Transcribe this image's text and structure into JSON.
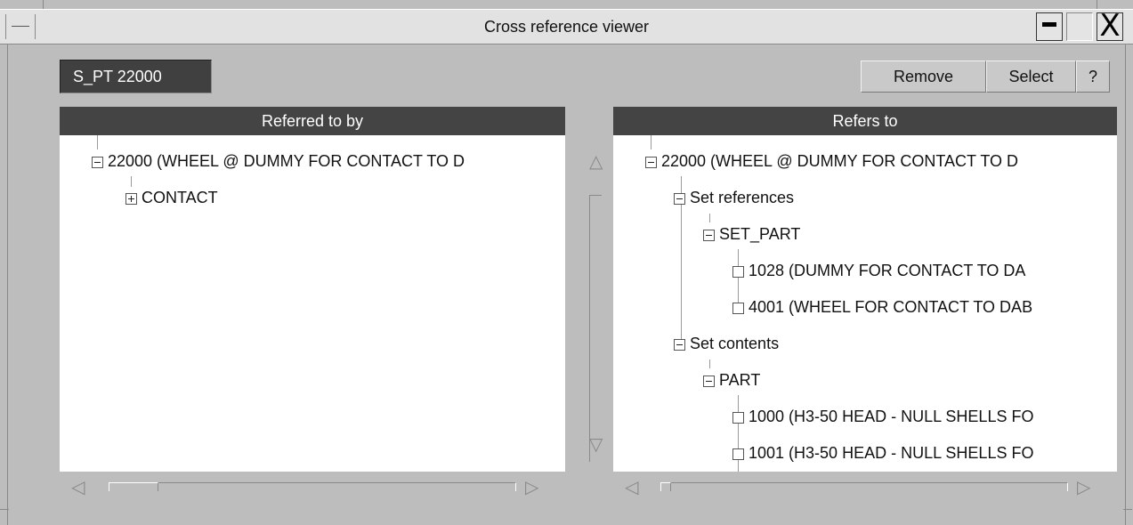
{
  "window": {
    "title": "Cross reference viewer",
    "close_glyph": "X"
  },
  "toolbar": {
    "entity_label": "S_PT 22000",
    "remove_label": "Remove",
    "select_label": "Select",
    "help_label": "?"
  },
  "left_panel": {
    "header": "Referred to by",
    "nodes": [
      {
        "label": "22000 (WHEEL @ DUMMY FOR CONTACT TO D",
        "state": "expanded"
      },
      {
        "label": "CONTACT",
        "state": "collapsed"
      }
    ]
  },
  "right_panel": {
    "header": "Refers to",
    "nodes": [
      {
        "label": "22000 (WHEEL @ DUMMY FOR CONTACT TO D",
        "state": "expanded"
      },
      {
        "label": "Set references",
        "state": "expanded"
      },
      {
        "label": "SET_PART",
        "state": "expanded"
      },
      {
        "label": "1028 (DUMMY FOR CONTACT TO DA",
        "state": "leaf"
      },
      {
        "label": "4001 (WHEEL FOR CONTACT TO DAB",
        "state": "leaf"
      },
      {
        "label": "Set contents",
        "state": "expanded"
      },
      {
        "label": "PART",
        "state": "expanded"
      },
      {
        "label": "1000 (H3-50 HEAD - NULL SHELLS FO",
        "state": "leaf"
      },
      {
        "label": "1001 (H3-50 HEAD - NULL SHELLS FO",
        "state": "leaf"
      }
    ]
  },
  "icons": {
    "expanded": "minus-box-icon",
    "collapsed": "plus-box-icon",
    "leaf": "empty-box-icon",
    "scroll_left": "◁",
    "scroll_right": "▷",
    "scroll_up": "△",
    "scroll_down": "▽"
  }
}
